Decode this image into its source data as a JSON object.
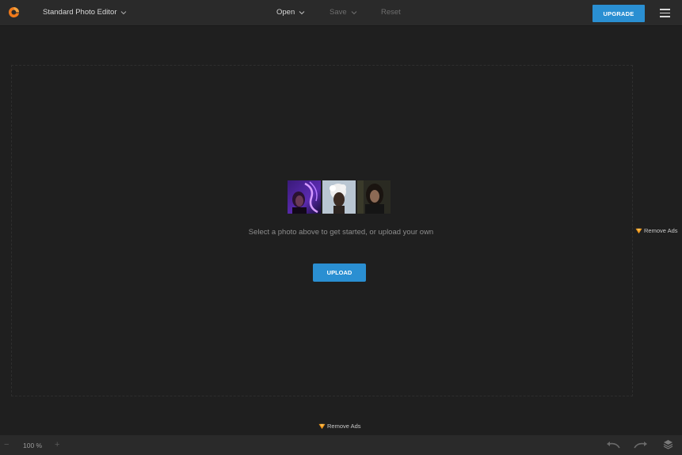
{
  "header": {
    "app_title": "Standard Photo Editor",
    "menu": {
      "open": "Open",
      "save": "Save",
      "reset": "Reset"
    },
    "upgrade_label": "UPGRADE"
  },
  "canvas": {
    "sample_photos": [
      "sample-photo-neon",
      "sample-photo-white-hair",
      "sample-photo-dark"
    ],
    "prompt": "Select a photo above to get started, or upload your own",
    "upload_label": "UPLOAD"
  },
  "ads": {
    "remove_ads_label": "Remove Ads"
  },
  "footer": {
    "zoom_minus": "−",
    "zoom_value": "100 %",
    "zoom_plus": "+"
  },
  "colors": {
    "accent": "#2a8fd2",
    "brand": "#f07a1a",
    "background": "#1f1f1f",
    "bar": "#2a2a2a"
  },
  "icons": [
    "logo-icon",
    "chevron-down-icon",
    "menu-icon",
    "crown-icon",
    "undo-icon",
    "redo-icon",
    "layers-icon"
  ]
}
